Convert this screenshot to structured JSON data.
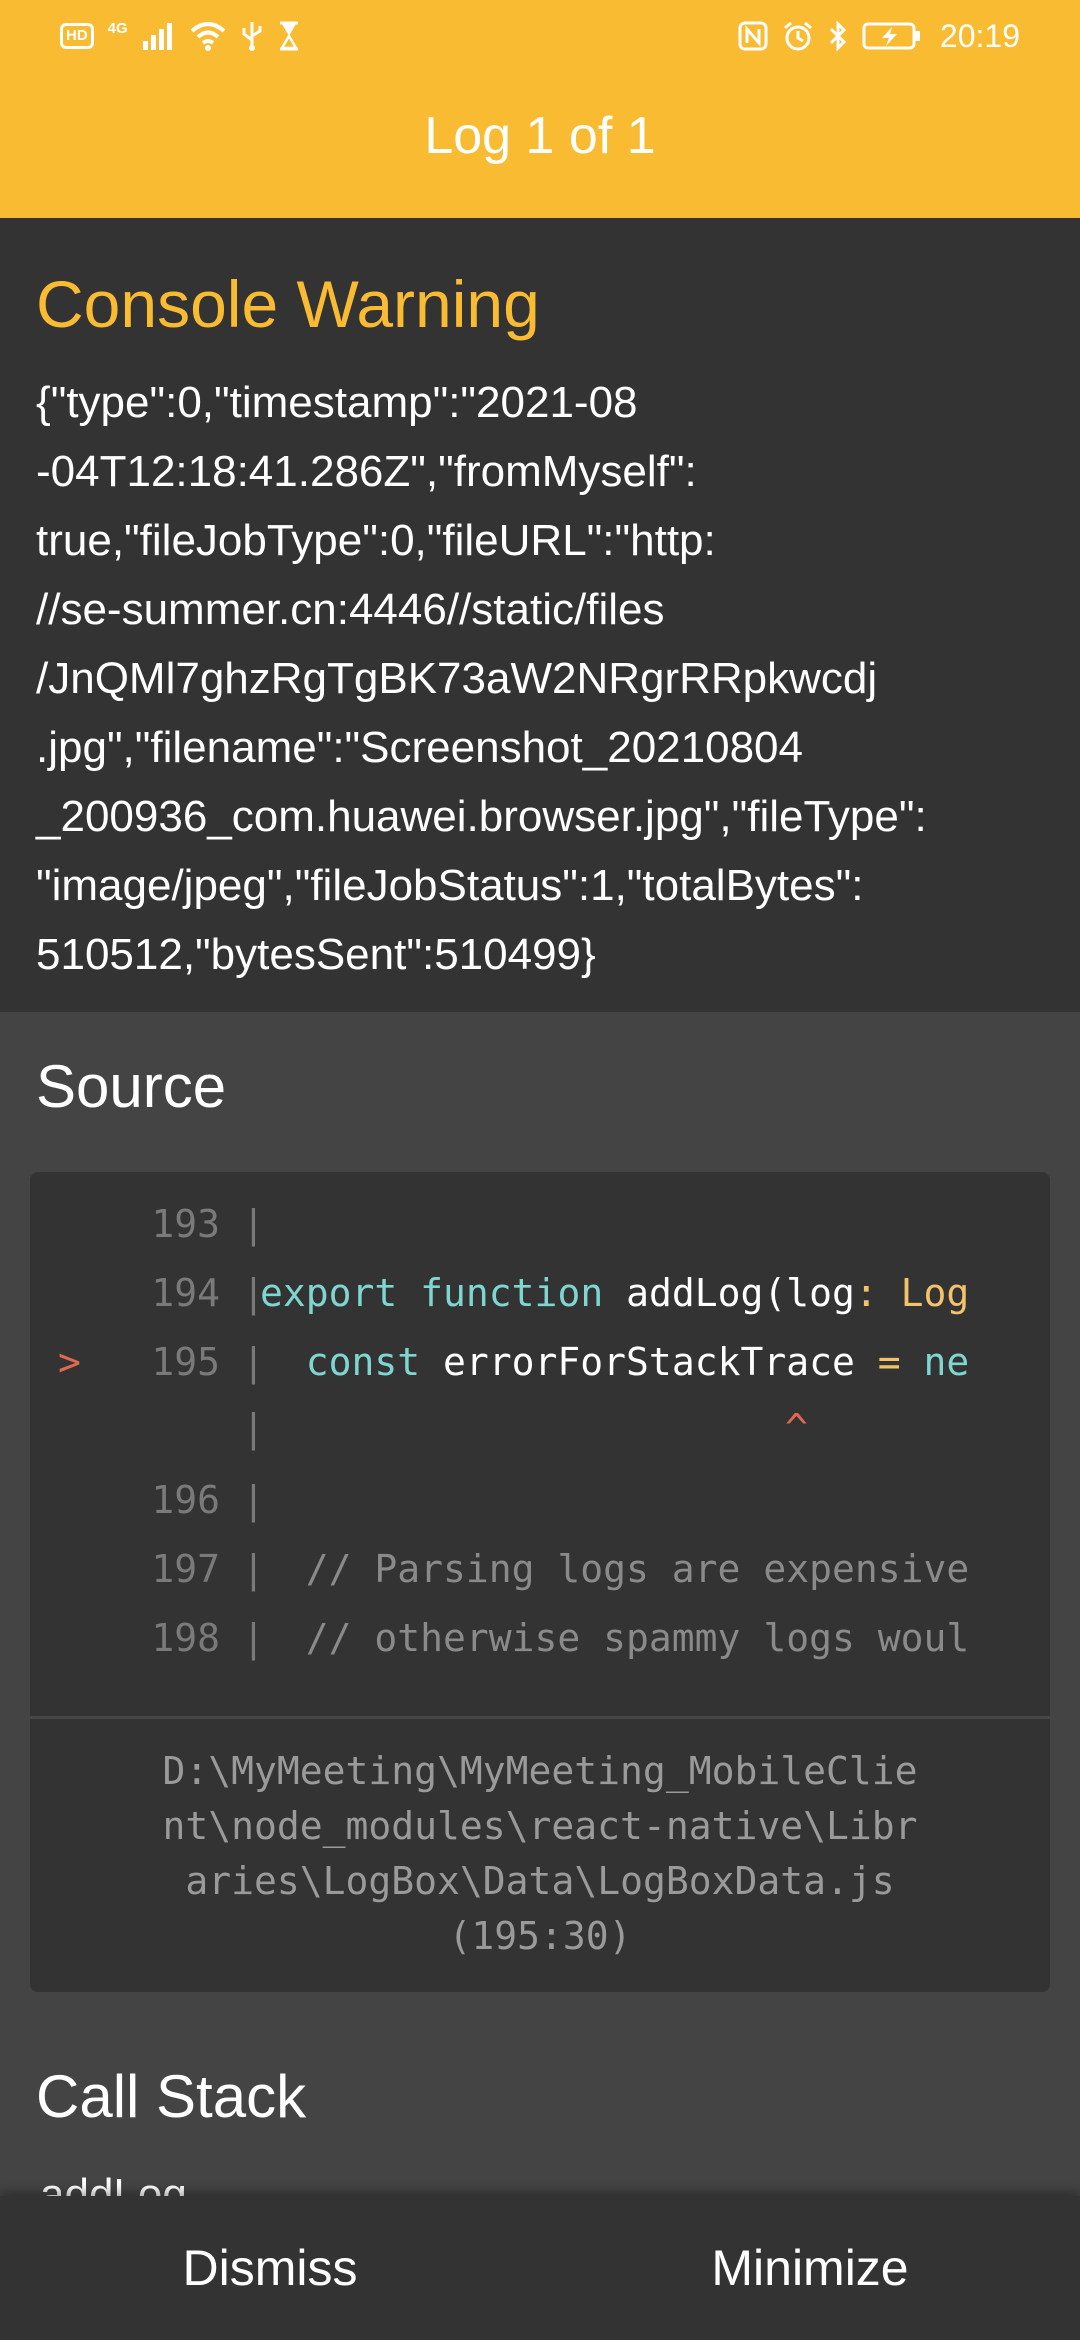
{
  "status_bar": {
    "left_indicators": {
      "hd_label": "HD",
      "network_label": "4G"
    },
    "time": "20:19",
    "icons": [
      "hd-icon",
      "signal-icon",
      "wifi-icon",
      "usb-icon",
      "hourglass-icon",
      "nfc-icon",
      "alarm-icon",
      "bluetooth-icon",
      "battery-charging-icon"
    ]
  },
  "header": {
    "title": "Log 1 of 1"
  },
  "warning": {
    "title": "Console Warning",
    "message_lines": [
      "{\"type\":0,\"timestamp\":\"2021-08",
      "-04T12:18:41.286Z\",\"fromMyself\":",
      "true,\"fileJobType\":0,\"fileURL\":\"http:",
      "//se-summer.cn:4446//static/files",
      "/JnQMl7ghzRgTgBK73aW2NRgrRRpkwcdj",
      ".jpg\",\"filename\":\"Screenshot_20210804",
      "_200936_com.huawei.browser.jpg\",\"fileType\":",
      "\"image/jpeg\",\"fileJobStatus\":1,\"totalBytes\":",
      "510512,\"bytesSent\":510499}"
    ]
  },
  "source": {
    "heading": "Source",
    "lines": [
      {
        "marker": "",
        "number": "193",
        "code": ""
      },
      {
        "marker": "",
        "number": "194",
        "code_parts": [
          "export",
          " ",
          "function",
          " addLog(log",
          ":",
          " Log"
        ]
      },
      {
        "marker": ">",
        "number": "195",
        "code_parts": [
          "  ",
          "const",
          " errorForStackTrace ",
          "=",
          " ne"
        ]
      },
      {
        "marker": "",
        "number": "",
        "caret": "^"
      },
      {
        "marker": "",
        "number": "196",
        "code": ""
      },
      {
        "marker": "",
        "number": "197",
        "comment": "  // Parsing logs are expensive"
      },
      {
        "marker": "",
        "number": "198",
        "comment": "  // otherwise spammy logs woul"
      }
    ],
    "pipe": "|",
    "file_path_lines": [
      "D:\\MyMeeting\\MyMeeting_MobileClie",
      "nt\\node_modules\\react-native\\Libr",
      "aries\\LogBox\\Data\\LogBoxData.js",
      "(195:30)"
    ]
  },
  "call_stack": {
    "heading": "Call Stack",
    "first_item_partial": "addLog"
  },
  "actions": {
    "dismiss_label": "Dismiss",
    "minimize_label": "Minimize"
  },
  "colors": {
    "accent": "#f9bb31",
    "panel": "#333333",
    "background": "#444444",
    "keyword": "#7fd6d0",
    "marker": "#e0694f"
  }
}
